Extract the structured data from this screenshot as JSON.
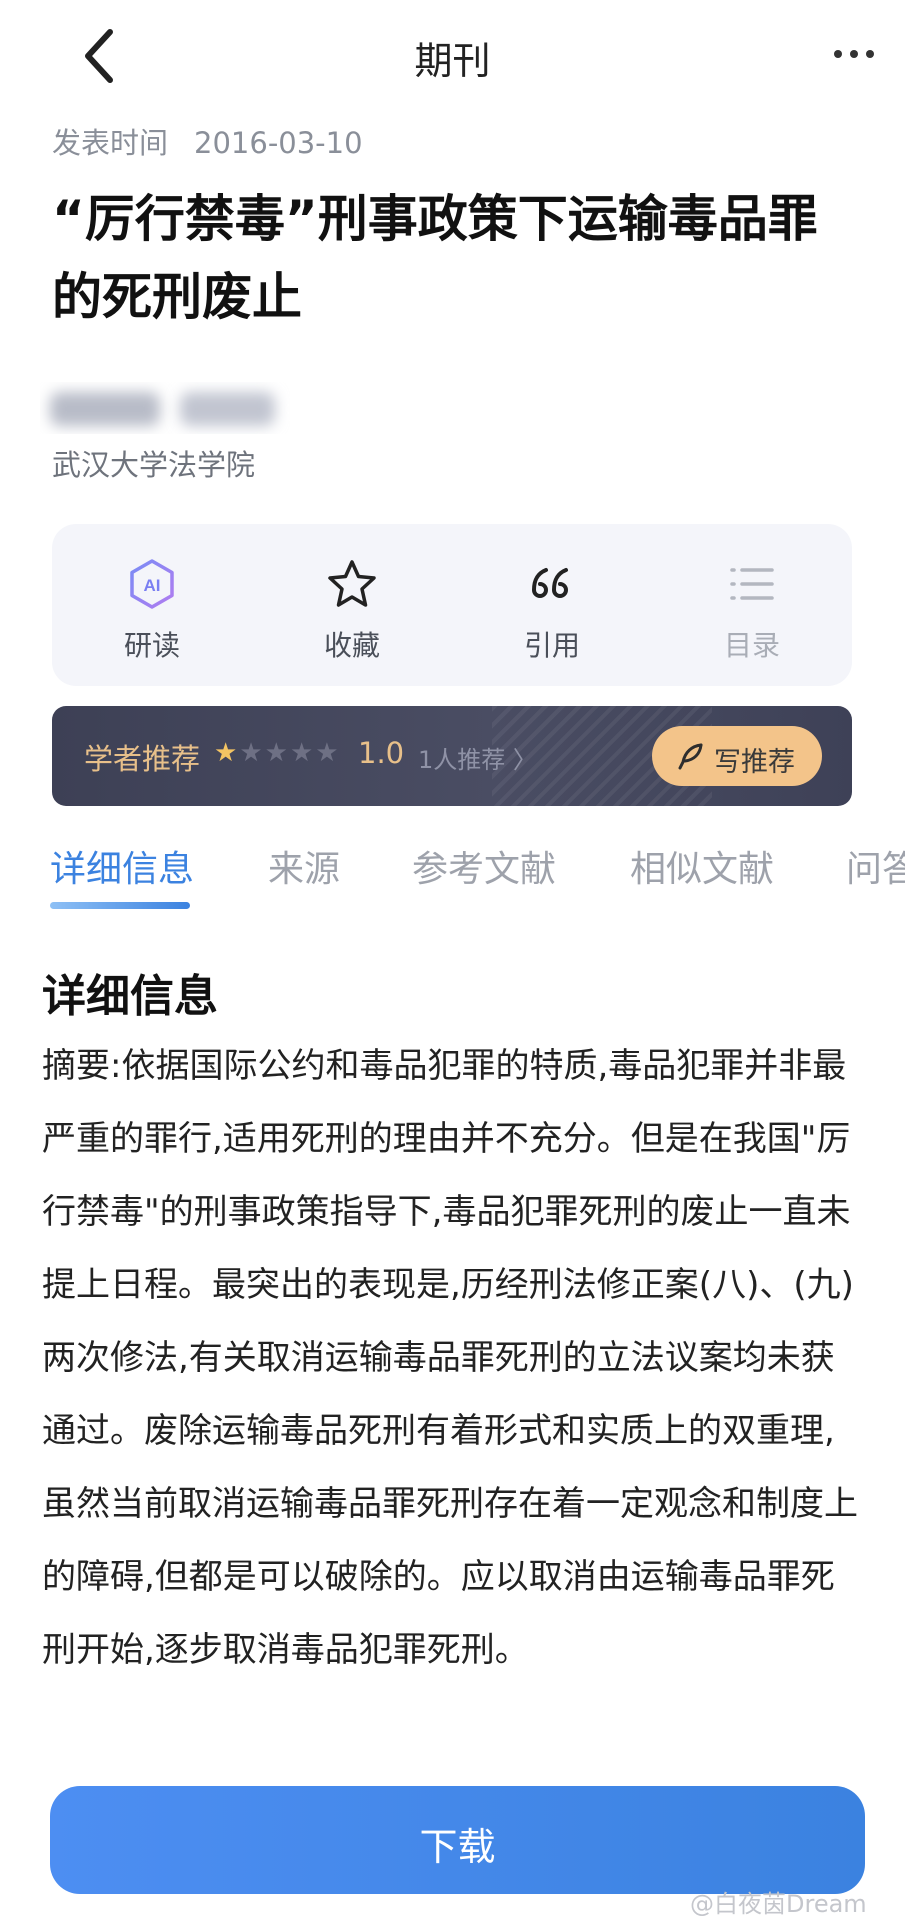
{
  "header": {
    "title": "期刊",
    "back_icon": "chevron-left-icon",
    "more_icon": "more-horizontal-icon"
  },
  "article": {
    "date_label": "发表时间",
    "date": "2016-03-10",
    "title": "“厉行禁毒”刑事政策下运输毒品罪的死刑废止",
    "affiliation": "武汉大学法学院"
  },
  "actions": [
    {
      "label": "研读",
      "icon": "ai-icon"
    },
    {
      "label": "收藏",
      "icon": "star-icon"
    },
    {
      "label": "引用",
      "icon": "quote-icon"
    },
    {
      "label": "目录",
      "icon": "list-icon"
    }
  ],
  "scholar": {
    "title": "学者推荐",
    "rating": 1,
    "rating_max": 5,
    "score": "1.0",
    "count": "1人推荐 〉",
    "write_label": "写推荐",
    "accent": "#f3c48a"
  },
  "tabs": [
    {
      "label": "详细信息",
      "active": true
    },
    {
      "label": "来源",
      "active": false
    },
    {
      "label": "参考文献",
      "active": false
    },
    {
      "label": "相似文献",
      "active": false
    },
    {
      "label": "问答",
      "active": false
    }
  ],
  "details": {
    "section_title": "详细信息",
    "abstract": "摘要:依据国际公约和毒品犯罪的特质,毒品犯罪并非最严重的罪行,适用死刑的理由并不充分。但是在我国\"厉行禁毒\"的刑事政策指导下,毒品犯罪死刑的废止一直未提上日程。最突出的表现是,历经刑法修正案(八)、(九)两次修法,有关取消运输毒品罪死刑的立法议案均未获通过。废除运输毒品死刑有着形式和实质上的双重理,虽然当前取消运输毒品罪死刑存在着一定观念和制度上的障碍,但都是可以破除的。应以取消由运输毒品罪死刑开始,逐步取消毒品犯罪死刑。"
  },
  "download": {
    "label": "下载",
    "color": "#3b82e0"
  },
  "watermark": "@白夜茵Dream"
}
